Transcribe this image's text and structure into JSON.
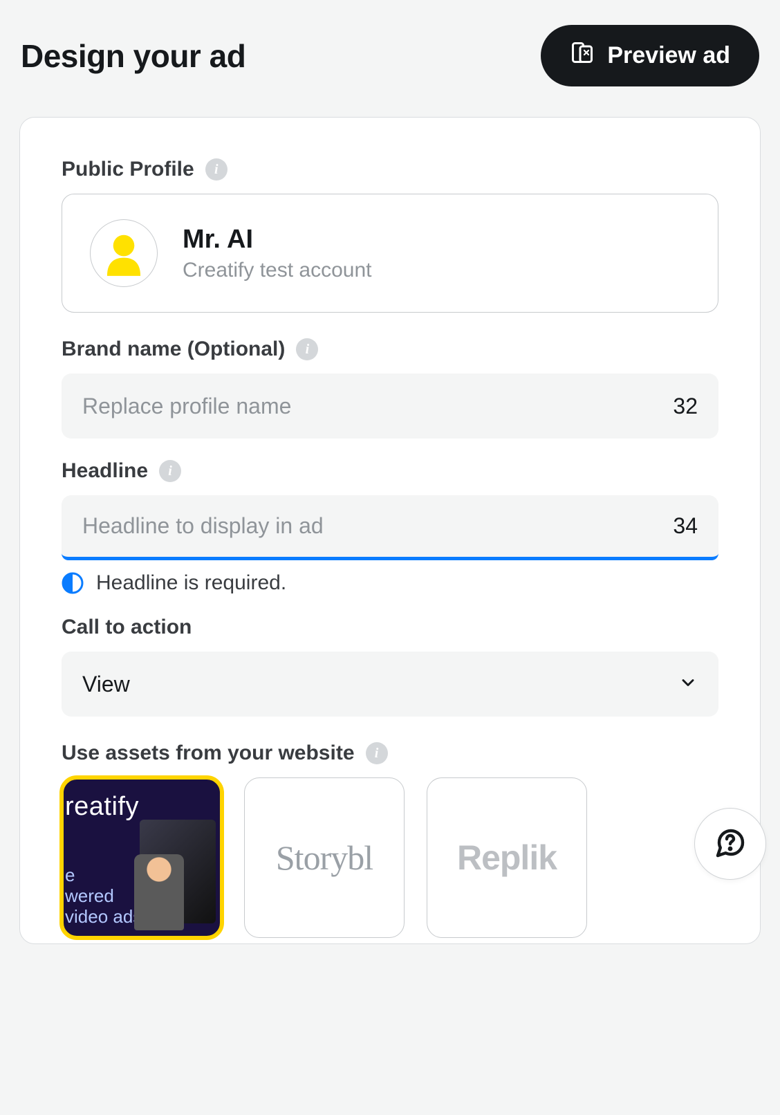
{
  "header": {
    "title": "Design your ad",
    "preview_button": "Preview ad"
  },
  "profile": {
    "section_label": "Public Profile",
    "name": "Mr. AI",
    "subtitle": "Creatify test account"
  },
  "brand_name": {
    "label": "Brand name (Optional)",
    "placeholder": "Replace profile name",
    "value": "",
    "char_limit": "32"
  },
  "headline": {
    "label": "Headline",
    "placeholder": "Headline to display in ad",
    "value": "",
    "char_limit": "34",
    "validation_message": "Headline is required."
  },
  "cta": {
    "label": "Call to action",
    "selected": "View"
  },
  "assets": {
    "label": "Use assets from your website",
    "items": [
      {
        "id": "asset-creatify",
        "brand_top": "reatify",
        "brand_sub": "e\nwered\nvideo ads",
        "selected": true,
        "style": "dark"
      },
      {
        "id": "asset-storyblocks",
        "text": "Storybl",
        "selected": false,
        "style": "light"
      },
      {
        "id": "asset-replika",
        "text": "Replik",
        "selected": false,
        "style": "light-bold"
      }
    ]
  }
}
